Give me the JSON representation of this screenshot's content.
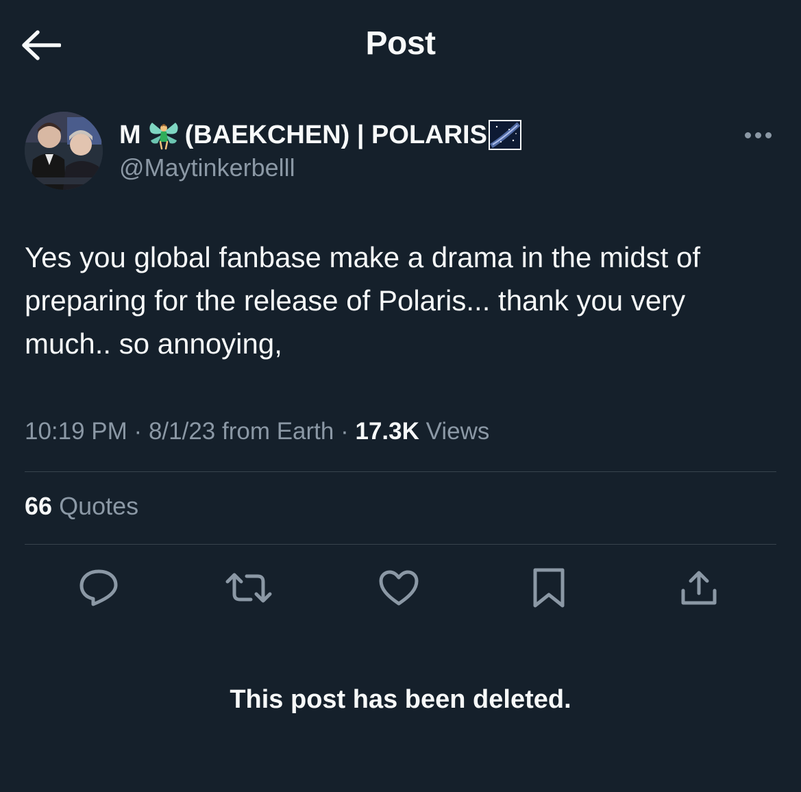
{
  "header": {
    "title": "Post",
    "back_icon": "arrow-left-icon"
  },
  "author": {
    "name_prefix": "M",
    "name_emoji_1": "fairy",
    "name_main": "(BAEKCHEN) | POLARIS",
    "name_emoji_2": "milky-way",
    "handle": "@Maytinkerbelll",
    "more_icon": "more-dots-icon"
  },
  "tweet": {
    "text": "Yes you global fanbase make a drama in the midst of preparing for the release of Polaris... thank you very much.. so annoying,"
  },
  "meta": {
    "time": "10:19 PM",
    "separator": "·",
    "date": "8/1/23",
    "source": "from Earth",
    "views_count": "17.3K",
    "views_label": "Views"
  },
  "stats": {
    "quotes_count": "66",
    "quotes_label": "Quotes"
  },
  "actions": [
    {
      "name": "reply",
      "icon": "reply-icon"
    },
    {
      "name": "retweet",
      "icon": "retweet-icon"
    },
    {
      "name": "like",
      "icon": "heart-icon"
    },
    {
      "name": "bookmark",
      "icon": "bookmark-icon"
    },
    {
      "name": "share",
      "icon": "share-icon"
    }
  ],
  "notice": {
    "deleted_text": "This post has been deleted."
  },
  "colors": {
    "background": "#15202b",
    "text_primary": "#f7f9f9",
    "text_secondary": "#8b98a5",
    "divider": "#38444d"
  }
}
